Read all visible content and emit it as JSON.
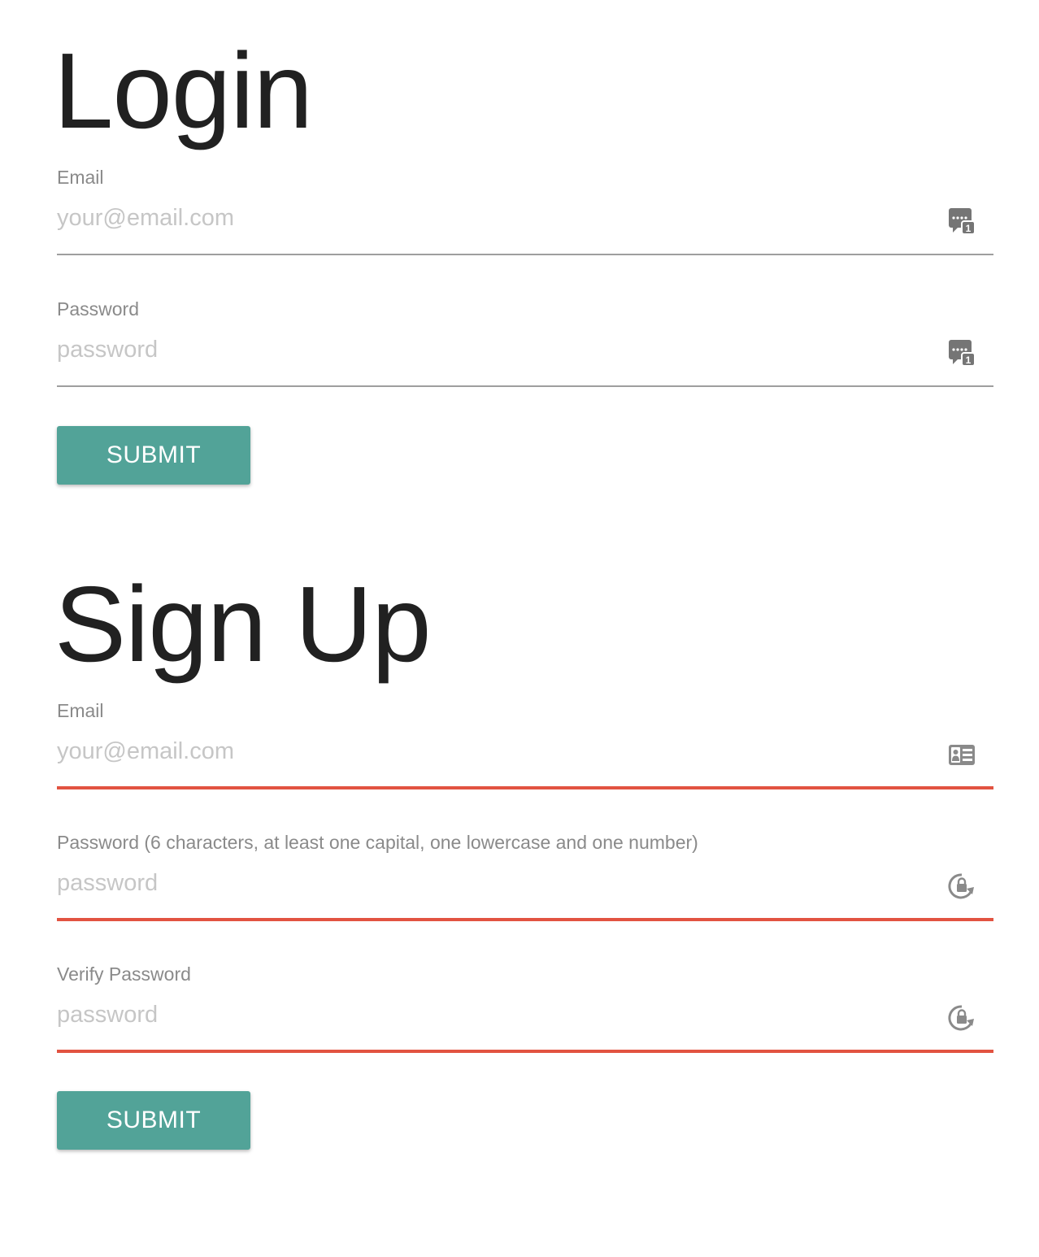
{
  "login": {
    "title": "Login",
    "email": {
      "label": "Email",
      "placeholder": "your@email.com",
      "value": "",
      "icon": "password-manager-icon"
    },
    "password": {
      "label": "Password",
      "placeholder": "password",
      "value": "",
      "icon": "password-manager-icon"
    },
    "submit_label": "SUBMIT"
  },
  "signup": {
    "title": "Sign Up",
    "email": {
      "label": "Email",
      "placeholder": "your@email.com",
      "value": "",
      "icon": "contact-card-icon",
      "state": "error"
    },
    "password": {
      "label": "Password (6 characters, at least one capital, one lowercase and one number)",
      "placeholder": "password",
      "value": "",
      "icon": "generate-password-icon",
      "state": "error"
    },
    "verify_password": {
      "label": "Verify Password",
      "placeholder": "password",
      "value": "",
      "icon": "generate-password-icon",
      "state": "error"
    },
    "submit_label": "SUBMIT"
  },
  "colors": {
    "accent": "#52a398",
    "error": "#e25341",
    "label": "#8a8a8a",
    "placeholder": "#c6c6c6"
  }
}
